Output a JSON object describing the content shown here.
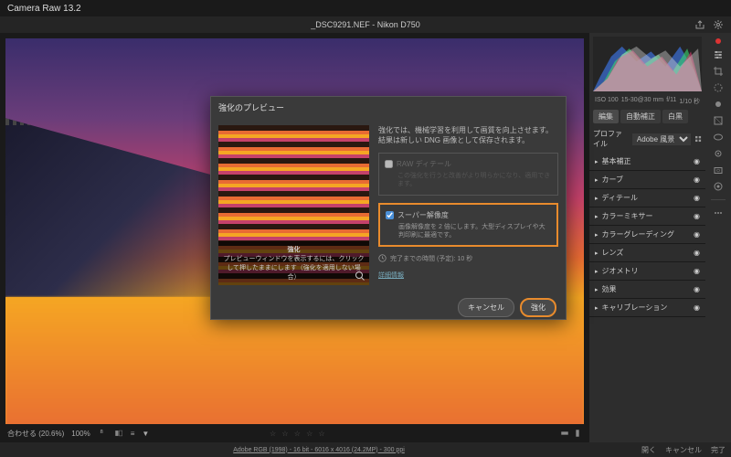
{
  "app": {
    "title": "Camera Raw 13.2"
  },
  "file": {
    "name": "_DSC9291.NEF",
    "camera": "Nikon D750"
  },
  "histogram": {
    "iso": "ISO 100",
    "lens": "15-30@30 mm",
    "aperture": "f/11",
    "shutter": "1/10 秒"
  },
  "tabs": {
    "edit": "編集",
    "auto": "自動補正",
    "bw": "白黒"
  },
  "profile": {
    "label": "プロファイル",
    "value": "Adobe 風景"
  },
  "accordion": [
    "基本補正",
    "カーブ",
    "ディテール",
    "カラーミキサー",
    "カラーグレーディング",
    "レンズ",
    "ジオメトリ",
    "効果",
    "キャリブレーション"
  ],
  "status": {
    "fit": "合わせる (20.6%)",
    "zoom": "100%"
  },
  "metadata": "Adobe RGB (1998) - 16 bit - 6016 x 4016 (24.2MP) - 300 ppi",
  "footer": {
    "open": "開く",
    "cancel": "キャンセル",
    "done": "完了"
  },
  "dialog": {
    "title": "強化のプレビュー",
    "desc": "強化では、機械学習を利用して画質を向上させます。結果は新しい DNG 画像として保存されます。",
    "raw_detail": {
      "label": "RAW ディテール",
      "sub": "この強化を行うと改善がより明らかになり、適用できます。"
    },
    "super_res": {
      "label": "スーパー解像度",
      "sub": "画像解像度を 2 倍にします。大型ディスプレイや大判印刷に最適です。"
    },
    "time": "完了までの時間 (予定): 10 秒",
    "link": "詳細情報",
    "preview_title": "強化",
    "preview_caption": "プレビューウィンドウを表示するには、クリックして押したままにします（強化を適用しない場合）",
    "cancel": "キャンセル",
    "apply": "強化"
  }
}
